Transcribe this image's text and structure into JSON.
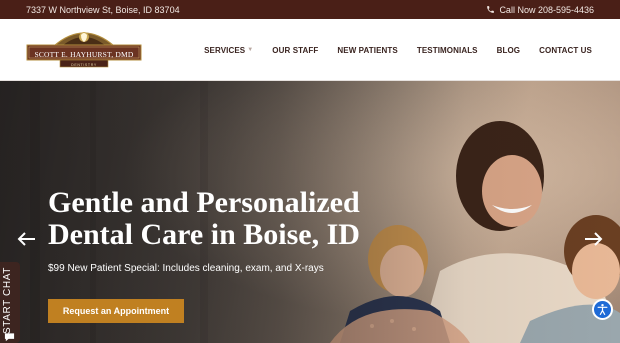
{
  "topbar": {
    "address": "7337 W Northview St, Boise, ID 83704",
    "phone": "Call Now 208-595-4436"
  },
  "logo": {
    "name": "SCOTT E. HAYHURST, DMD",
    "sub": "DENTISTRY"
  },
  "nav": {
    "items": [
      {
        "label": "SERVICES",
        "dropdown": true
      },
      {
        "label": "OUR STAFF"
      },
      {
        "label": "NEW PATIENTS"
      },
      {
        "label": "TESTIMONIALS"
      },
      {
        "label": "BLOG"
      },
      {
        "label": "CONTACT US"
      }
    ]
  },
  "hero": {
    "title_line1": "Gentle and Personalized",
    "title_line2": "Dental Care in Boise, ID",
    "subtitle": "$99 New Patient Special: Includes cleaning, exam, and X-rays",
    "cta": "Request an Appointment"
  },
  "chat": {
    "label": "START CHAT"
  },
  "colors": {
    "topbar": "#4a1f17",
    "cta": "#c08021",
    "accessibility": "#1e6ad6",
    "chat": "#3d2520"
  },
  "icons": {
    "phone": "phone-icon",
    "prev": "arrow-left-icon",
    "next": "arrow-right-icon",
    "chat": "chat-bubble-icon",
    "accessibility": "accessibility-icon",
    "chevron": "chevron-down-icon"
  }
}
